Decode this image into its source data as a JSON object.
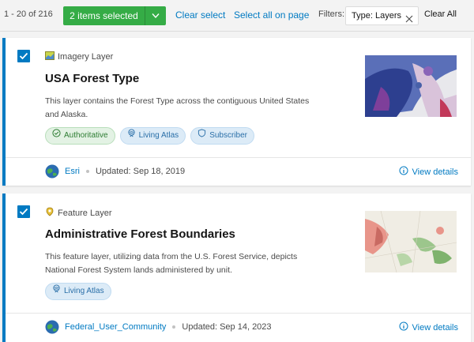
{
  "toolbar": {
    "count": "1 - 20 of 216",
    "selected_label": "2 items selected",
    "clear_select": "Clear select",
    "select_all_on_page": "Select all on page",
    "filters_label": "Filters:",
    "filter_chip": "Type: Layers",
    "clear_all": "Clear All"
  },
  "colors": {
    "accent": "#007ac2",
    "selected_button": "#35ac46",
    "authoritative_tag": "#2e7d33",
    "info_tag": "#2a6fa8"
  },
  "items": [
    {
      "selected": true,
      "type_icon": "imagery-layer-icon",
      "type": "Imagery Layer",
      "title": "USA Forest Type",
      "description": "This layer contains the Forest Type across the contiguous United States and Alaska.",
      "tags": [
        {
          "label": "Authoritative",
          "icon": "check-circle-icon"
        },
        {
          "label": "Living Atlas",
          "icon": "living-atlas-icon"
        },
        {
          "label": "Subscriber",
          "icon": "shield-icon"
        }
      ],
      "owner": "Esri",
      "updated": "Updated: Sep 18, 2019",
      "view_details": "View details"
    },
    {
      "selected": true,
      "type_icon": "feature-layer-icon",
      "type": "Feature Layer",
      "title": "Administrative Forest Boundaries",
      "description": "This feature layer, utilizing data from the U.S. Forest Service, depicts National Forest System lands administered by unit.",
      "tags": [
        {
          "label": "Living Atlas",
          "icon": "living-atlas-icon"
        }
      ],
      "owner": "Federal_User_Community",
      "updated": "Updated: Sep 14, 2023",
      "view_details": "View details"
    }
  ]
}
